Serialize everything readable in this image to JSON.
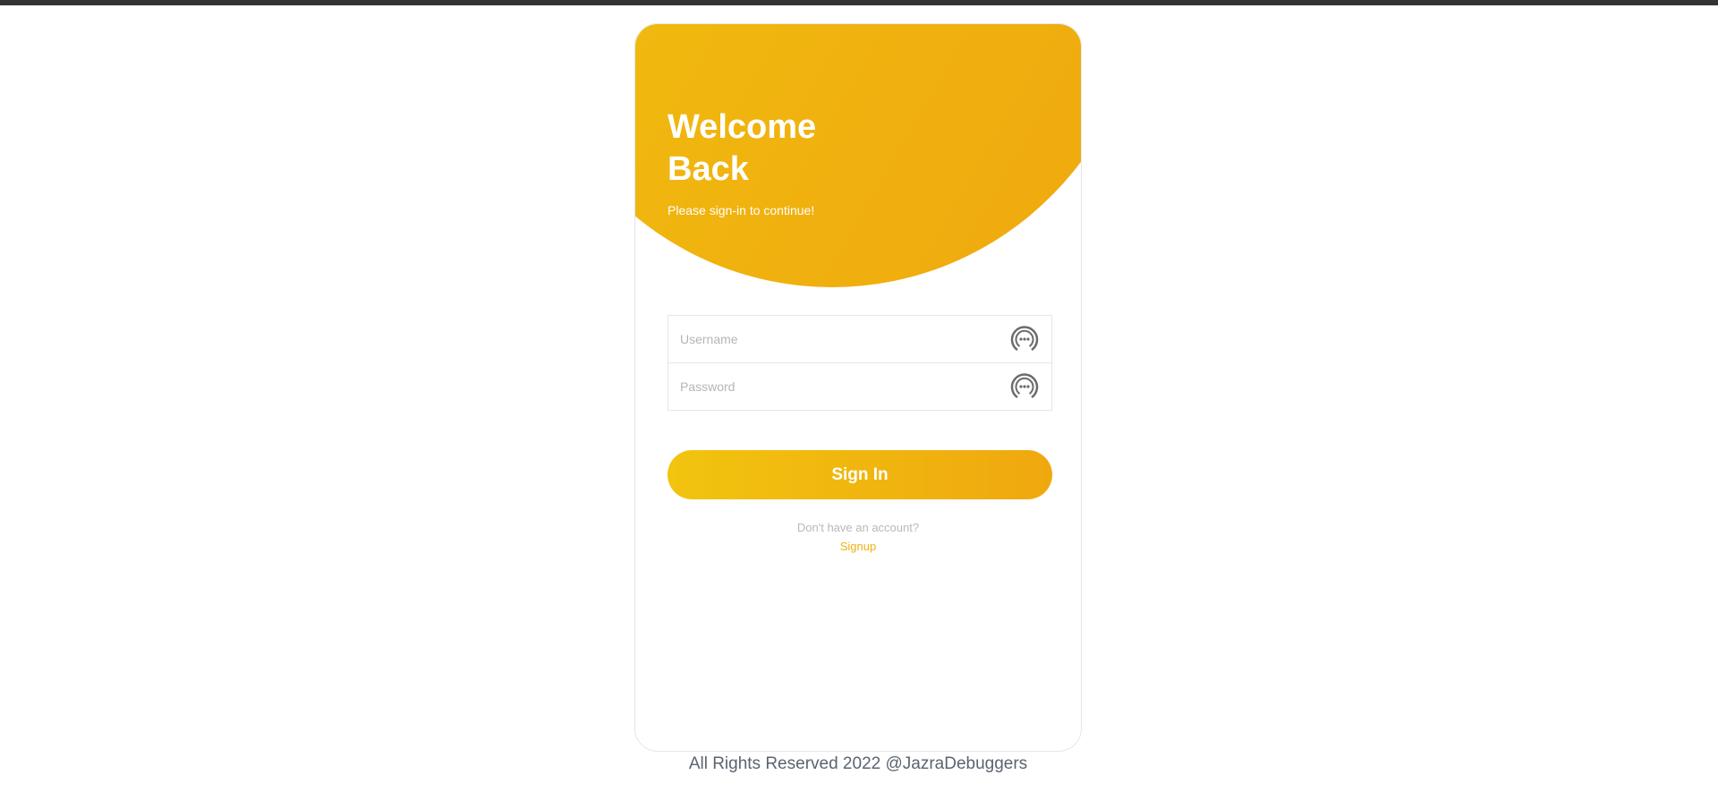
{
  "hero": {
    "title": "Welcome Back",
    "subtitle": "Please sign-in to continue!"
  },
  "form": {
    "username_placeholder": "Username",
    "password_placeholder": "Password",
    "field_icon": "chat-dots-icon"
  },
  "signin": {
    "label": "Sign In"
  },
  "account": {
    "question": "Don't have an account?",
    "signup_label": "Signup"
  },
  "footer": {
    "text": "All Rights Reserved 2022 @JazraDebuggers"
  },
  "colors": {
    "accent_start": "#f1c40f",
    "accent_end": "#f0a80f",
    "topbar": "#333333"
  }
}
